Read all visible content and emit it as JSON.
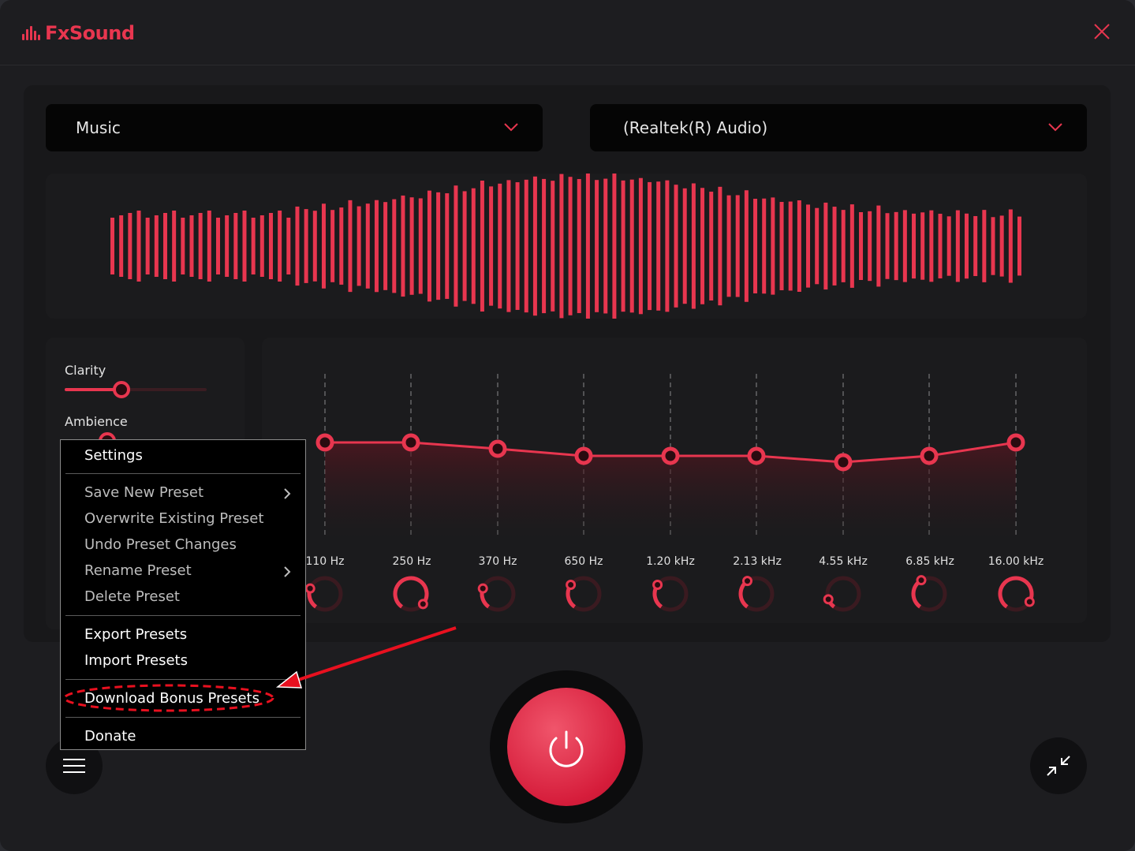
{
  "app": {
    "title": "FxSound",
    "accent": "#e8364f"
  },
  "preset_dropdown": {
    "value": "Music"
  },
  "device_dropdown": {
    "value": "(Realtek(R) Audio)"
  },
  "effects": [
    {
      "label": "Clarity",
      "value": 0.4
    },
    {
      "label": "Ambience",
      "value": 0.3
    }
  ],
  "eq": {
    "bands": [
      "110 Hz",
      "250 Hz",
      "370 Hz",
      "650 Hz",
      "1.20 kHz",
      "2.13 kHz",
      "4.55 kHz",
      "6.85 kHz",
      "16.00 kHz"
    ]
  },
  "menu": {
    "settings": "Settings",
    "save_new_preset": "Save New Preset",
    "overwrite_existing_preset": "Overwrite Existing Preset",
    "undo_preset_changes": "Undo Preset Changes",
    "rename_preset": "Rename Preset",
    "delete_preset": "Delete Preset",
    "export_presets": "Export Presets",
    "import_presets": "Import Presets",
    "download_bonus_presets": "Download Bonus Presets",
    "donate": "Donate"
  },
  "icons": {
    "close": "close-icon",
    "chevron": "chevron-down-icon",
    "power": "power-icon",
    "menu": "hamburger-menu-icon",
    "minimize": "collapse-icon"
  }
}
